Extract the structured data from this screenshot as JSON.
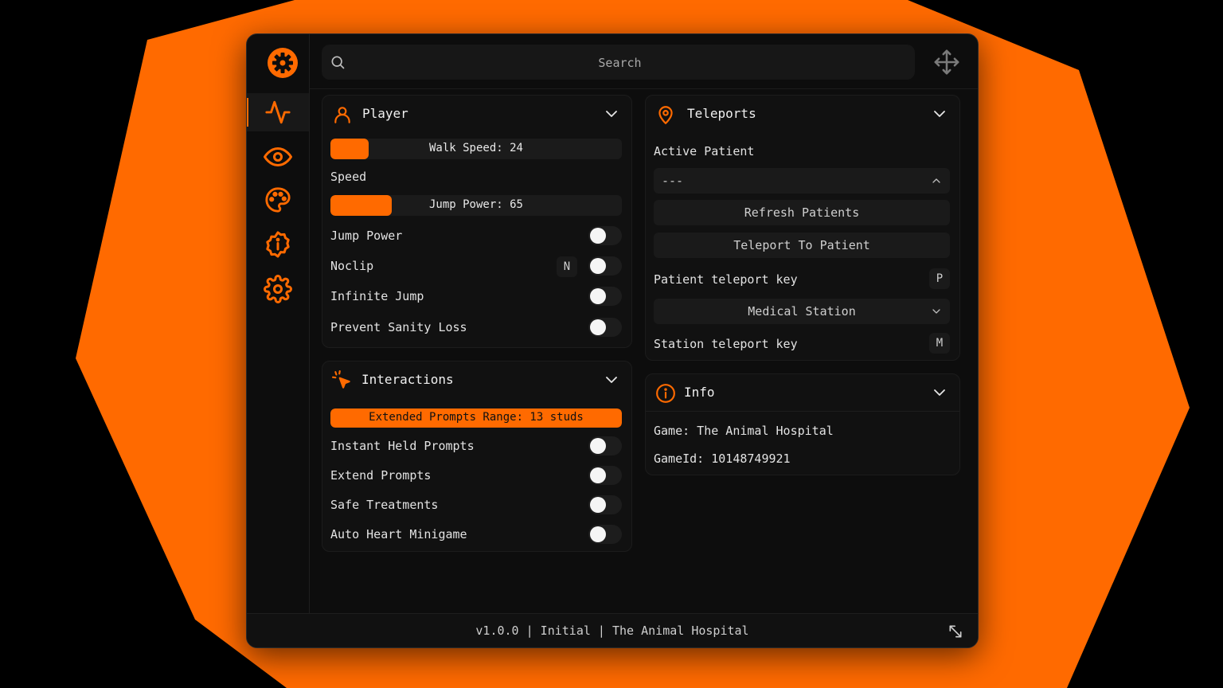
{
  "colors": {
    "accent": "#ff6a00",
    "background": "#000000",
    "panel": "#0d0d0d"
  },
  "search": {
    "placeholder": "Search"
  },
  "sidebar": {
    "items": [
      {
        "icon": "activity-icon",
        "active": true
      },
      {
        "icon": "eye-icon",
        "active": false
      },
      {
        "icon": "palette-icon",
        "active": false
      },
      {
        "icon": "info-icon",
        "active": false
      },
      {
        "icon": "gear-icon",
        "active": false
      }
    ]
  },
  "player": {
    "title": "Player",
    "walk_speed": {
      "label": "Walk Speed: 24",
      "fill": 0.13
    },
    "speed_label": "Speed",
    "jump_power": {
      "label": "Jump Power: 65",
      "fill": 0.21
    },
    "toggles": [
      {
        "label": "Jump Power",
        "key": "",
        "on": false
      },
      {
        "label": "Noclip",
        "key": "N",
        "on": false
      },
      {
        "label": "Infinite Jump",
        "key": "",
        "on": false
      },
      {
        "label": "Prevent Sanity Loss",
        "key": "",
        "on": false
      }
    ]
  },
  "interactions": {
    "title": "Interactions",
    "range": {
      "label": "Extended Prompts Range: 13 studs",
      "fill": 1.0
    },
    "toggles": [
      {
        "label": "Instant Held Prompts",
        "on": false
      },
      {
        "label": "Extend Prompts",
        "on": false
      },
      {
        "label": "Safe Treatments",
        "on": false
      },
      {
        "label": "Auto Heart Minigame",
        "on": false
      }
    ]
  },
  "teleports": {
    "title": "Teleports",
    "active_patient_label": "Active Patient",
    "active_patient_value": "---",
    "refresh_button": "Refresh Patients",
    "teleport_button": "Teleport To Patient",
    "patient_key_label": "Patient teleport key",
    "patient_key": "P",
    "station_value": "Medical Station",
    "station_key_label": "Station teleport key",
    "station_key": "M"
  },
  "info": {
    "title": "Info",
    "game": "Game: The Animal Hospital",
    "game_id": "GameId: 10148749921"
  },
  "footer": {
    "text": "v1.0.0 | Initial | The Animal Hospital"
  }
}
